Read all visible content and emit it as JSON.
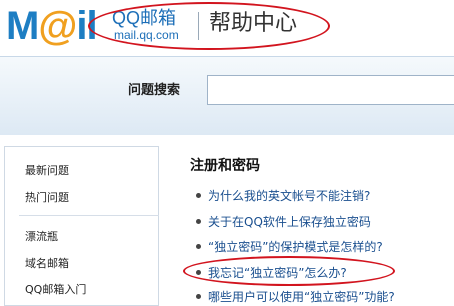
{
  "header": {
    "logo_text_main": "M",
    "logo_text_a": "@",
    "logo_text_rest": "il",
    "logo_qq": "QQ邮箱",
    "logo_url": "mail.qq.com",
    "title": "帮助中心"
  },
  "search": {
    "label": "问题搜索",
    "value": ""
  },
  "sidebar": {
    "items": [
      {
        "label": "最新问题"
      },
      {
        "label": "热门问题"
      },
      {
        "label": "漂流瓶"
      },
      {
        "label": "域名邮箱"
      },
      {
        "label": "QQ邮箱入门"
      }
    ]
  },
  "main": {
    "section_title": "注册和密码",
    "questions": [
      {
        "label": "为什么我的英文帐号不能注销?"
      },
      {
        "label": "关于在QQ软件上保存独立密码"
      },
      {
        "label": "“独立密码”的保护模式是怎样的?"
      },
      {
        "label": "我忘记“独立密码”怎么办?"
      },
      {
        "label": "哪些用户可以使用“独立密码”功能?"
      }
    ]
  },
  "colors": {
    "brand_blue": "#1d7ec3",
    "link_blue": "#1a4f8f",
    "annotation_red": "#d2141e"
  }
}
